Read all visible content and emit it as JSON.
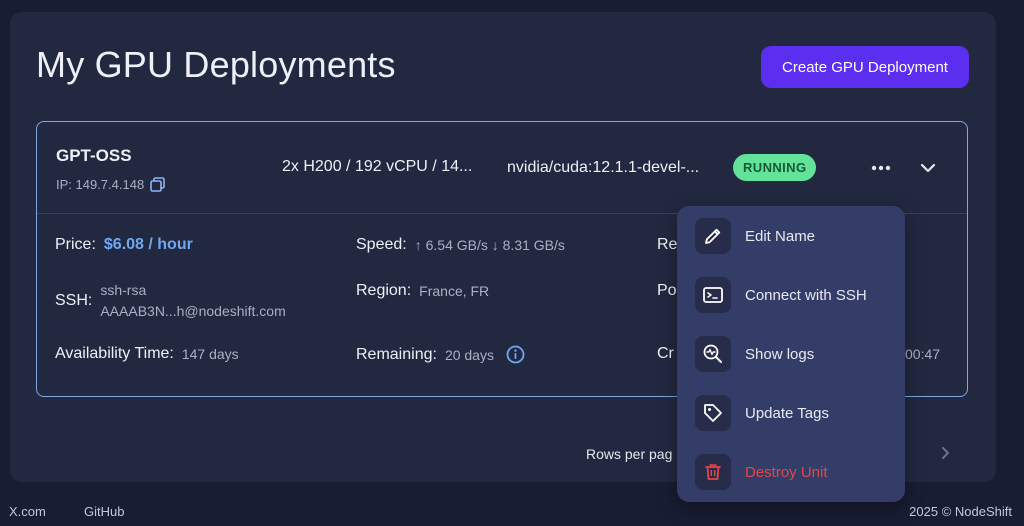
{
  "header": {
    "title": "My GPU Deployments",
    "create_label": "Create GPU Deployment"
  },
  "deployment": {
    "name": "GPT-OSS",
    "ip": "IP: 149.7.4.148",
    "spec": "2x H200 / 192 vCPU / 14...",
    "image": "nvidia/cuda:12.1.1-devel-...",
    "status": "RUNNING",
    "details": {
      "price_label": "Price:",
      "price_value": "$6.08 / hour",
      "speed_label": "Speed:",
      "speed_value": "↑ 6.54 GB/s ↓ 8.31 GB/s",
      "ssh_label": "SSH:",
      "ssh_value_1": "ssh-rsa",
      "ssh_value_2": "AAAAB3N...h@nodeshift.com",
      "region_label": "Region:",
      "region_value": "France, FR",
      "availability_label": "Availability Time:",
      "availability_value": "147 days",
      "remaining_label": "Remaining:",
      "remaining_value": "20 days",
      "col3_row1_partial": "Re",
      "col3_row2_partial": "Po",
      "col3_row3_partial": "Cr",
      "col3_row3_tail": "00:47"
    }
  },
  "menu": {
    "items": [
      {
        "label": "Edit Name",
        "icon": "pencil-icon"
      },
      {
        "label": "Connect with SSH",
        "icon": "terminal-icon"
      },
      {
        "label": "Show logs",
        "icon": "logs-icon"
      },
      {
        "label": "Update Tags",
        "icon": "tag-icon"
      },
      {
        "label": "Destroy Unit",
        "icon": "trash-icon"
      }
    ]
  },
  "pagination": {
    "rows_per_page_partial": "Rows per pag"
  },
  "footer": {
    "links": [
      "X.com",
      "GitHub"
    ],
    "copyright": "2025 © NodeShift"
  },
  "colors": {
    "accent": "#5b2ef0",
    "running": "#63e39a",
    "danger": "#e04848",
    "price": "#6fa8f2",
    "border": "#7fa6e0"
  }
}
